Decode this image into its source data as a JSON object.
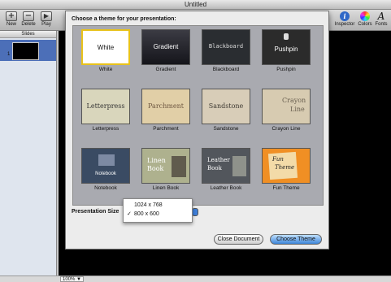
{
  "window": {
    "title": "Untitled"
  },
  "toolbar": {
    "new_label": "New",
    "delete_label": "Delete",
    "play_label": "Play",
    "new_icon": "+",
    "delete_icon": "−",
    "play_icon": "▶",
    "inspector_label": "Inspector",
    "colors_label": "Colors",
    "fonts_label": "Fonts",
    "inspector_icon": "i",
    "fonts_icon": "A"
  },
  "sidebar": {
    "header": "Slides",
    "slides": [
      {
        "number": "1"
      }
    ]
  },
  "status": {
    "zoom": "100%",
    "zoom_icon": "▼"
  },
  "sheet": {
    "title": "Choose a theme for your presentation:",
    "themes": [
      {
        "label": "White",
        "thumb_text": "White",
        "icon": "white-theme-thumbnail"
      },
      {
        "label": "Gradient",
        "thumb_text": "Gradient",
        "icon": "gradient-theme-thumbnail"
      },
      {
        "label": "Blackboard",
        "thumb_text": "Blackboard",
        "icon": "blackboard-theme-thumbnail"
      },
      {
        "label": "Pushpin",
        "thumb_text": "Pushpin",
        "icon": "pushpin-theme-thumbnail"
      },
      {
        "label": "Letterpress",
        "thumb_text": "Letterpress",
        "icon": "letterpress-theme-thumbnail"
      },
      {
        "label": "Parchment",
        "thumb_text": "Parchment",
        "icon": "parchment-theme-thumbnail"
      },
      {
        "label": "Sandstone",
        "thumb_text": "Sandstone",
        "icon": "sandstone-theme-thumbnail"
      },
      {
        "label": "Crayon Line",
        "thumb_text_1": "Crayon",
        "thumb_text_2": "Line",
        "icon": "crayon-line-theme-thumbnail"
      },
      {
        "label": "Notebook",
        "thumb_text": "Notebook",
        "icon": "notebook-theme-thumbnail"
      },
      {
        "label": "Linen Book",
        "thumb_text_1": "Linen",
        "thumb_text_2": "Book",
        "icon": "linen-book-theme-thumbnail"
      },
      {
        "label": "Leather Book",
        "thumb_text_1": "Leather",
        "thumb_text_2": "Book",
        "icon": "leather-book-theme-thumbnail"
      },
      {
        "label": "Fun Theme",
        "thumb_text_1": "Fun",
        "thumb_text_2": "Theme",
        "icon": "fun-theme-thumbnail"
      }
    ],
    "size_label": "Presentation Size",
    "size_options": [
      {
        "label": "1024 x 768",
        "check": ""
      },
      {
        "label": "800 x 600",
        "check": "✓"
      }
    ],
    "close_button": "Close Document",
    "choose_button": "Choose Theme"
  },
  "colors": {
    "selection": "#4c6fb8",
    "primary_button": "#3d85d8"
  }
}
